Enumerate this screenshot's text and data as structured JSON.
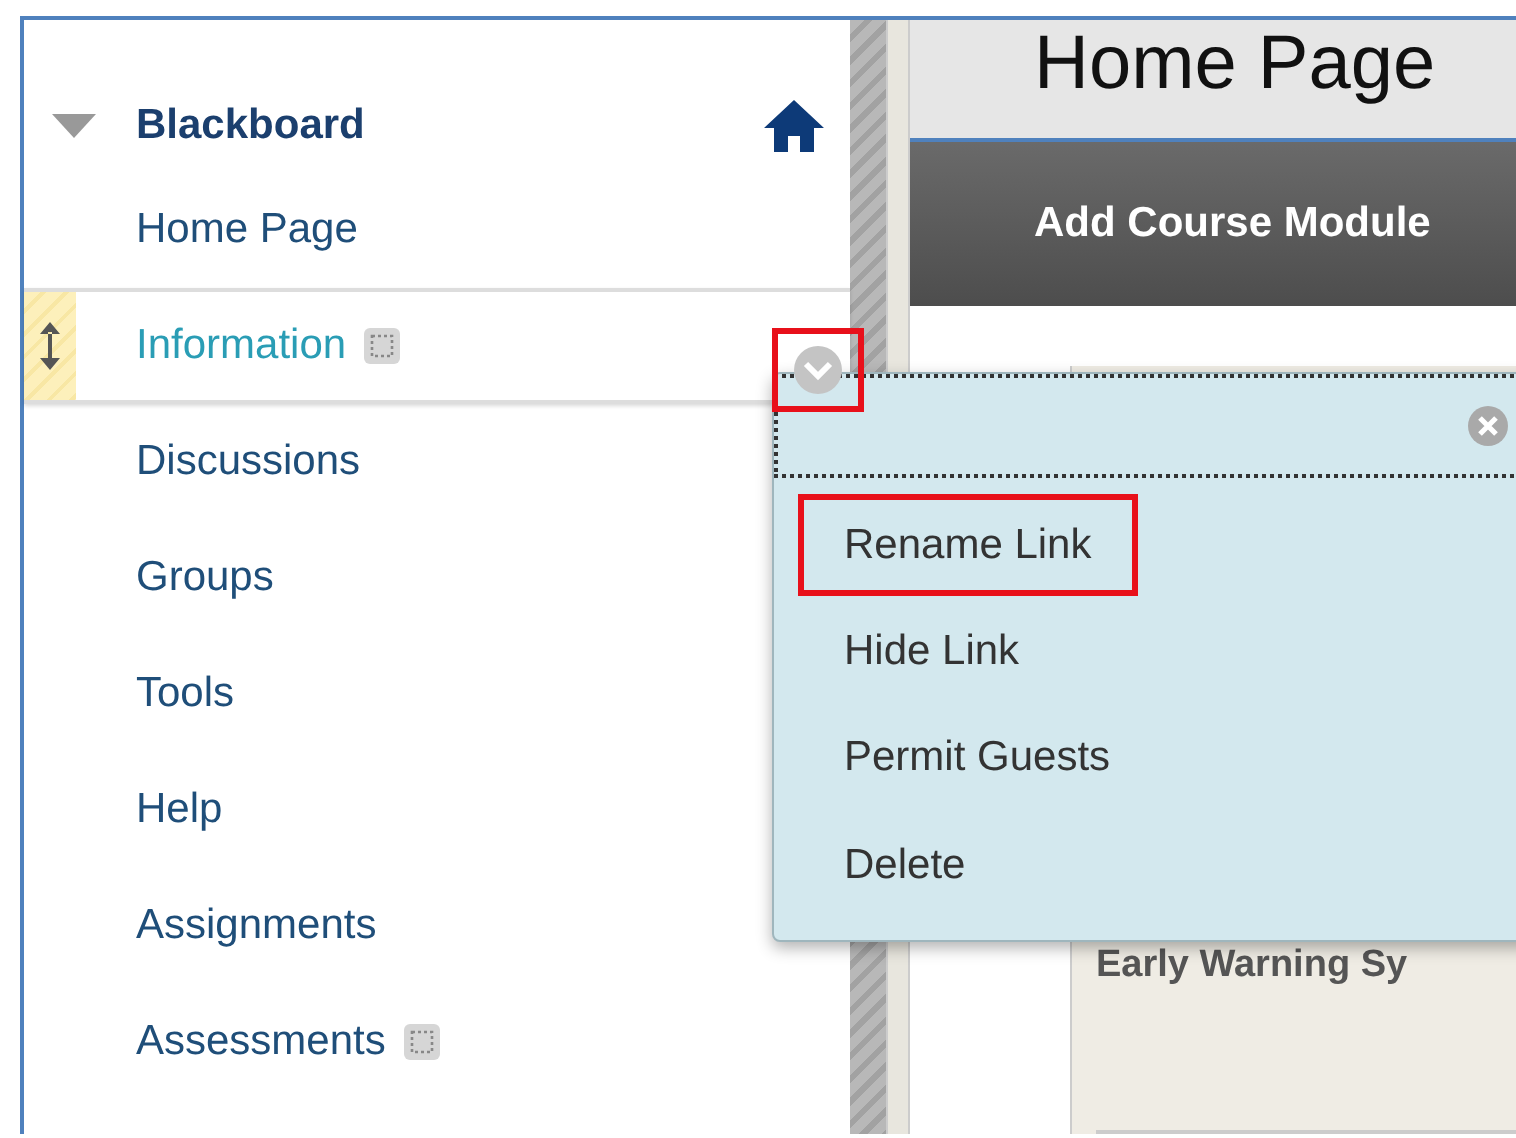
{
  "sidebar": {
    "title": "Blackboard",
    "expanded": true,
    "items": [
      {
        "label": "Home Page",
        "selected": false,
        "marker": false
      },
      {
        "label": "Information",
        "selected": true,
        "marker": true
      },
      {
        "label": "Discussions",
        "selected": false,
        "marker": false
      },
      {
        "label": "Groups",
        "selected": false,
        "marker": false
      },
      {
        "label": "Tools",
        "selected": false,
        "marker": false
      },
      {
        "label": "Help",
        "selected": false,
        "marker": false
      },
      {
        "label": "Assignments",
        "selected": false,
        "marker": false
      },
      {
        "label": "Assessments",
        "selected": false,
        "marker": true
      }
    ]
  },
  "content": {
    "page_title": "Home Page",
    "action_bar": "Add Course Module",
    "module_title": "Early Warning Sy"
  },
  "context_menu": {
    "trigger_annotated": true,
    "items": [
      {
        "label": "Rename Link",
        "annotated": true
      },
      {
        "label": "Hide Link",
        "annotated": false
      },
      {
        "label": "Permit Guests",
        "annotated": false
      },
      {
        "label": "Delete",
        "annotated": false
      }
    ]
  }
}
